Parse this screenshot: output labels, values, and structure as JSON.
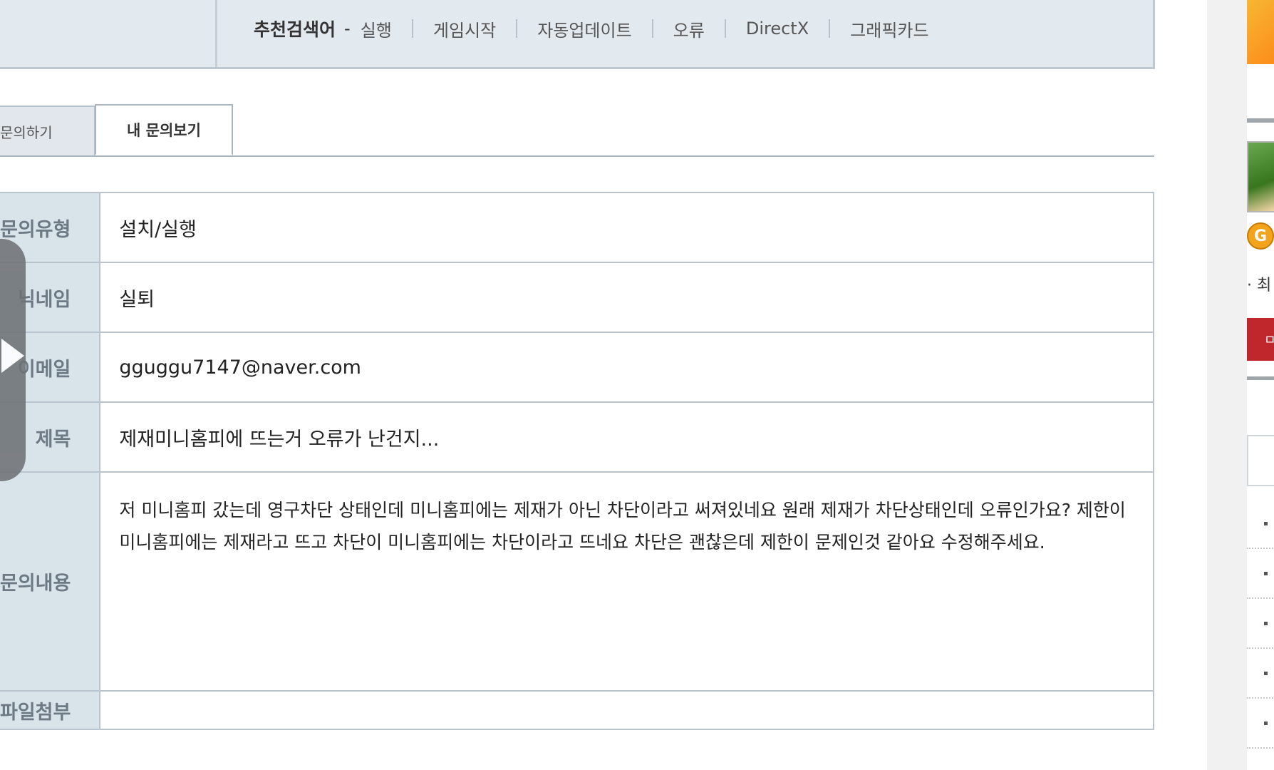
{
  "keywords": {
    "title": "추천검색어",
    "dash": "-",
    "items": [
      "실행",
      "게임시작",
      "자동업데이트",
      "오류",
      "DirectX",
      "그래픽카드"
    ]
  },
  "tabs": {
    "ask": "문의하기",
    "mine": "내 문의보기"
  },
  "detail": {
    "type_label": "문의유형",
    "type_value": "설치/실행",
    "nick_label": "닉네임",
    "nick_value": "실퇴",
    "email_label": "이메일",
    "email_value": "gguggu7147@naver.com",
    "subject_label": "제목",
    "subject_value": "제재미니홈피에 뜨는거 오류가 난건지...",
    "content_label": "문의내용",
    "content_value": "저 미니홈피 갔는데 영구차단 상태인데 미니홈피에는 제재가 아닌 차단이라고 써져있네요 원래 제재가 차단상태인데 오류인가요? 제한이 미니홈피에는 제재라고 뜨고 차단이 미니홈피에는 차단이라고 뜨네요 차단은 괜찮은데 제한이 문제인것 같아요 수정해주세요.",
    "file_label": "파일첨부",
    "file_value": ""
  },
  "sidebar": {
    "coin_letter": "G",
    "text": "최",
    "button": "ㅁ"
  },
  "colors": {
    "topbar_bg": "#e3eaef",
    "header_cell_bg": "#d9e3ea",
    "border": "#b8c4ce",
    "red_button": "#c0272d"
  }
}
